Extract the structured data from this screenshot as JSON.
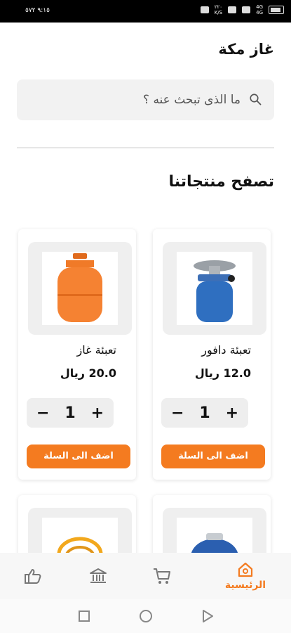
{
  "status_bar": {
    "time": "٩:١٥ ٥٧٢",
    "net_top": "٢٢٠",
    "net_bottom": "K/S",
    "sim1": "4G",
    "sim2": "4G"
  },
  "header": {
    "store_name": "غاز مكة"
  },
  "search": {
    "placeholder": "ما الذى تبحث عنه ؟"
  },
  "section": {
    "title": "تصفح منتجاتنا"
  },
  "products": [
    {
      "name": "تعبئة دافور",
      "price": "12.0 ريال",
      "quantity": "1",
      "minus": "−",
      "plus": "+",
      "add_label": "اضف الى السلة"
    },
    {
      "name": "تعبئة غاز",
      "price": "20.0 ريال",
      "quantity": "1",
      "minus": "−",
      "plus": "+",
      "add_label": "اضف الى السلة"
    }
  ],
  "tabs": [
    {
      "name": "home",
      "label": "الرئيسية",
      "active": true
    },
    {
      "name": "cart",
      "label": ""
    },
    {
      "name": "bank",
      "label": ""
    },
    {
      "name": "likes",
      "label": ""
    }
  ],
  "colors": {
    "accent": "#f47b20",
    "card_bg": "#efefef"
  }
}
